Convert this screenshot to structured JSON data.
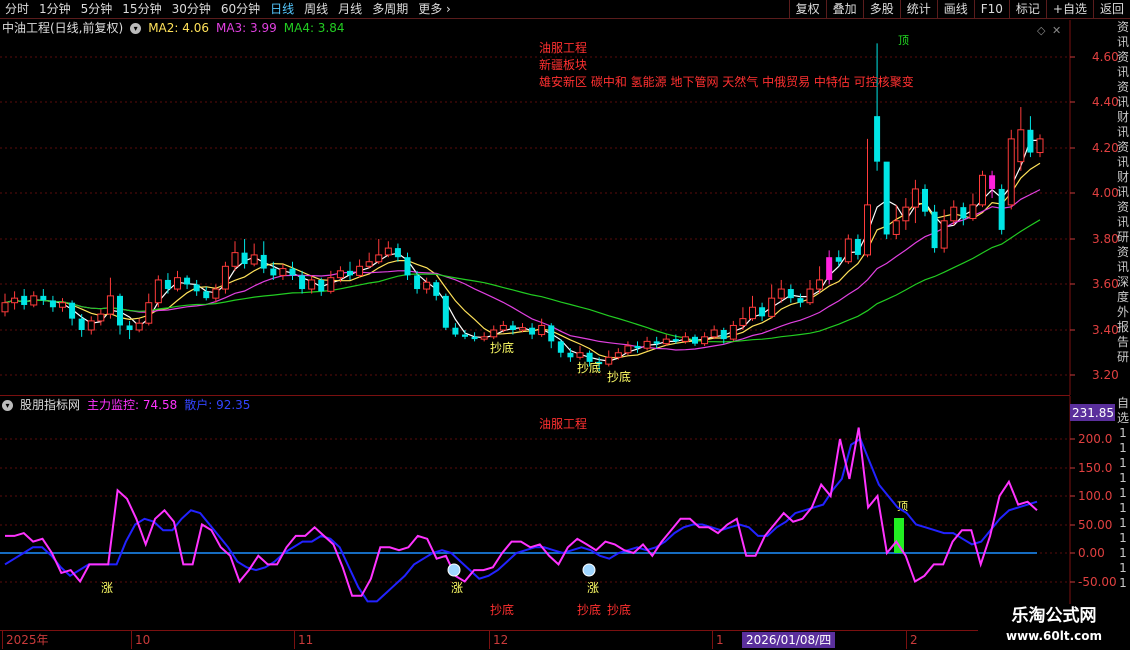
{
  "toolbar": {
    "periods": [
      "分时",
      "1分钟",
      "5分钟",
      "15分钟",
      "30分钟",
      "60分钟",
      "日线",
      "周线",
      "月线",
      "多周期",
      "更多"
    ],
    "active_period": "日线",
    "more_arrow": "›",
    "right_buttons": [
      "复权",
      "叠加",
      "多股",
      "统计",
      "画线",
      "F10",
      "标记",
      "+自选",
      "返回"
    ]
  },
  "main": {
    "title": "中油工程(日线,前复权)",
    "ma2": "MA2: 4.06",
    "ma3": "MA3: 3.99",
    "ma4": "MA4: 3.84",
    "annotations": [
      "油服工程",
      "新疆板块",
      "雄安新区 碳中和 氢能源 地下管网 天然气 中俄贸易 中特估 可控核聚变"
    ],
    "marker_top": "顶",
    "signals": [
      "抄底",
      "抄底",
      "抄底"
    ],
    "price_ticks": [
      "4.60",
      "4.40",
      "4.20",
      "4.00",
      "3.80",
      "3.60",
      "3.40",
      "3.20"
    ]
  },
  "sub": {
    "title": "股朋指标网",
    "main_force": "主力监控: 74.58",
    "retail": "散户: 92.35",
    "annotation": "油服工程",
    "current_value": "231.85",
    "ticks": [
      "200.0",
      "150.0",
      "100.0",
      "50.00",
      "0.00",
      "-50.00"
    ],
    "up_labels": [
      "涨",
      "涨",
      "涨"
    ],
    "signals": [
      "抄底",
      "抄底",
      "抄底"
    ],
    "top_label": "顶"
  },
  "dates": {
    "labels": [
      "2025年",
      "10",
      "11",
      "12",
      "1",
      "2"
    ],
    "cursor": "2026/01/08/四"
  },
  "right_strip": [
    "资",
    "讯",
    "资",
    "讯",
    "资",
    "讯",
    "财",
    "讯",
    "资",
    "讯",
    "财",
    "讯",
    "资",
    "讯",
    "研",
    "资",
    "讯",
    "深",
    "度",
    "外",
    "报",
    "告",
    "研"
  ],
  "sub_right_strip": [
    "自",
    "选",
    "1",
    "1",
    "1",
    "1",
    "1",
    "1",
    "1",
    "1",
    "1",
    "1",
    "1"
  ],
  "watermark": {
    "line1": "乐淘公式网",
    "line2": "www.60lt.com"
  },
  "colors": {
    "up": "#ff3b3b",
    "down": "#00e5e5",
    "ma2": "#ffffff",
    "ma3": "#ffe25a",
    "ma4": "#e040e0",
    "ma5": "#22cc22",
    "main_force": "#ff33ff",
    "retail": "#2222ff",
    "zero_line": "#1e90ff",
    "grid": "#7a1010"
  }
}
